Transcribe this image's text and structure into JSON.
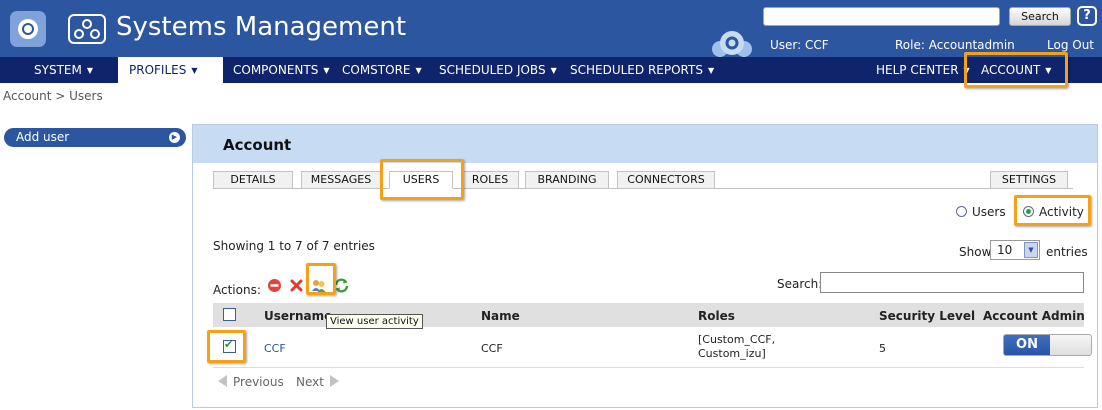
{
  "header": {
    "title": "Systems Management",
    "search_button": "Search",
    "help_icon": "?",
    "user": "User: CCF",
    "role": "Role:  Accountadmin",
    "logout": "Log Out"
  },
  "nav": {
    "items": [
      {
        "label": "SYSTEM"
      },
      {
        "label": "PROFILES"
      },
      {
        "label": "COMPONENTS"
      },
      {
        "label": "COMSTORE"
      },
      {
        "label": "SCHEDULED JOBS"
      },
      {
        "label": "SCHEDULED REPORTS"
      },
      {
        "label": "HELP CENTER"
      },
      {
        "label": "ACCOUNT"
      }
    ],
    "active": "PROFILES"
  },
  "breadcrumb": "Account > Users",
  "sidebar": {
    "add_user": "Add user"
  },
  "panel": {
    "title": "Account",
    "tabs": [
      "DETAILS",
      "MESSAGES",
      "USERS",
      "ROLES",
      "BRANDING",
      "CONNECTORS"
    ],
    "settings_tab": "SETTINGS",
    "active_tab": "USERS",
    "view_options": [
      "Users",
      "Activity"
    ],
    "selected_view": "Activity",
    "showing": "Showing 1 to 7 of 7 entries",
    "show_label": "Show",
    "page_size": "10",
    "entries_label": "entries",
    "actions_label": "Actions:",
    "search_label": "Search:",
    "search_value": "",
    "action_icons": [
      "remove-icon",
      "delete-icon",
      "view-activity-icon",
      "refresh-icon"
    ]
  },
  "table": {
    "columns": [
      "Username",
      "Name",
      "Roles",
      "Security Level",
      "Account Admin"
    ],
    "rows": [
      {
        "username": "CCF",
        "name": "CCF",
        "roles_line1": "[Custom_CCF,",
        "roles_line2": "Custom_izu]",
        "security_level": "5",
        "account_admin": "ON",
        "checked": true
      }
    ]
  },
  "pager": {
    "previous": "Previous",
    "next": "Next"
  },
  "tooltip": "View user activity",
  "colors": {
    "header_blue": "#2d56a0",
    "nav_navy": "#10246b",
    "panel_head": "#c7dcf3",
    "highlight": "#f4a11a"
  }
}
